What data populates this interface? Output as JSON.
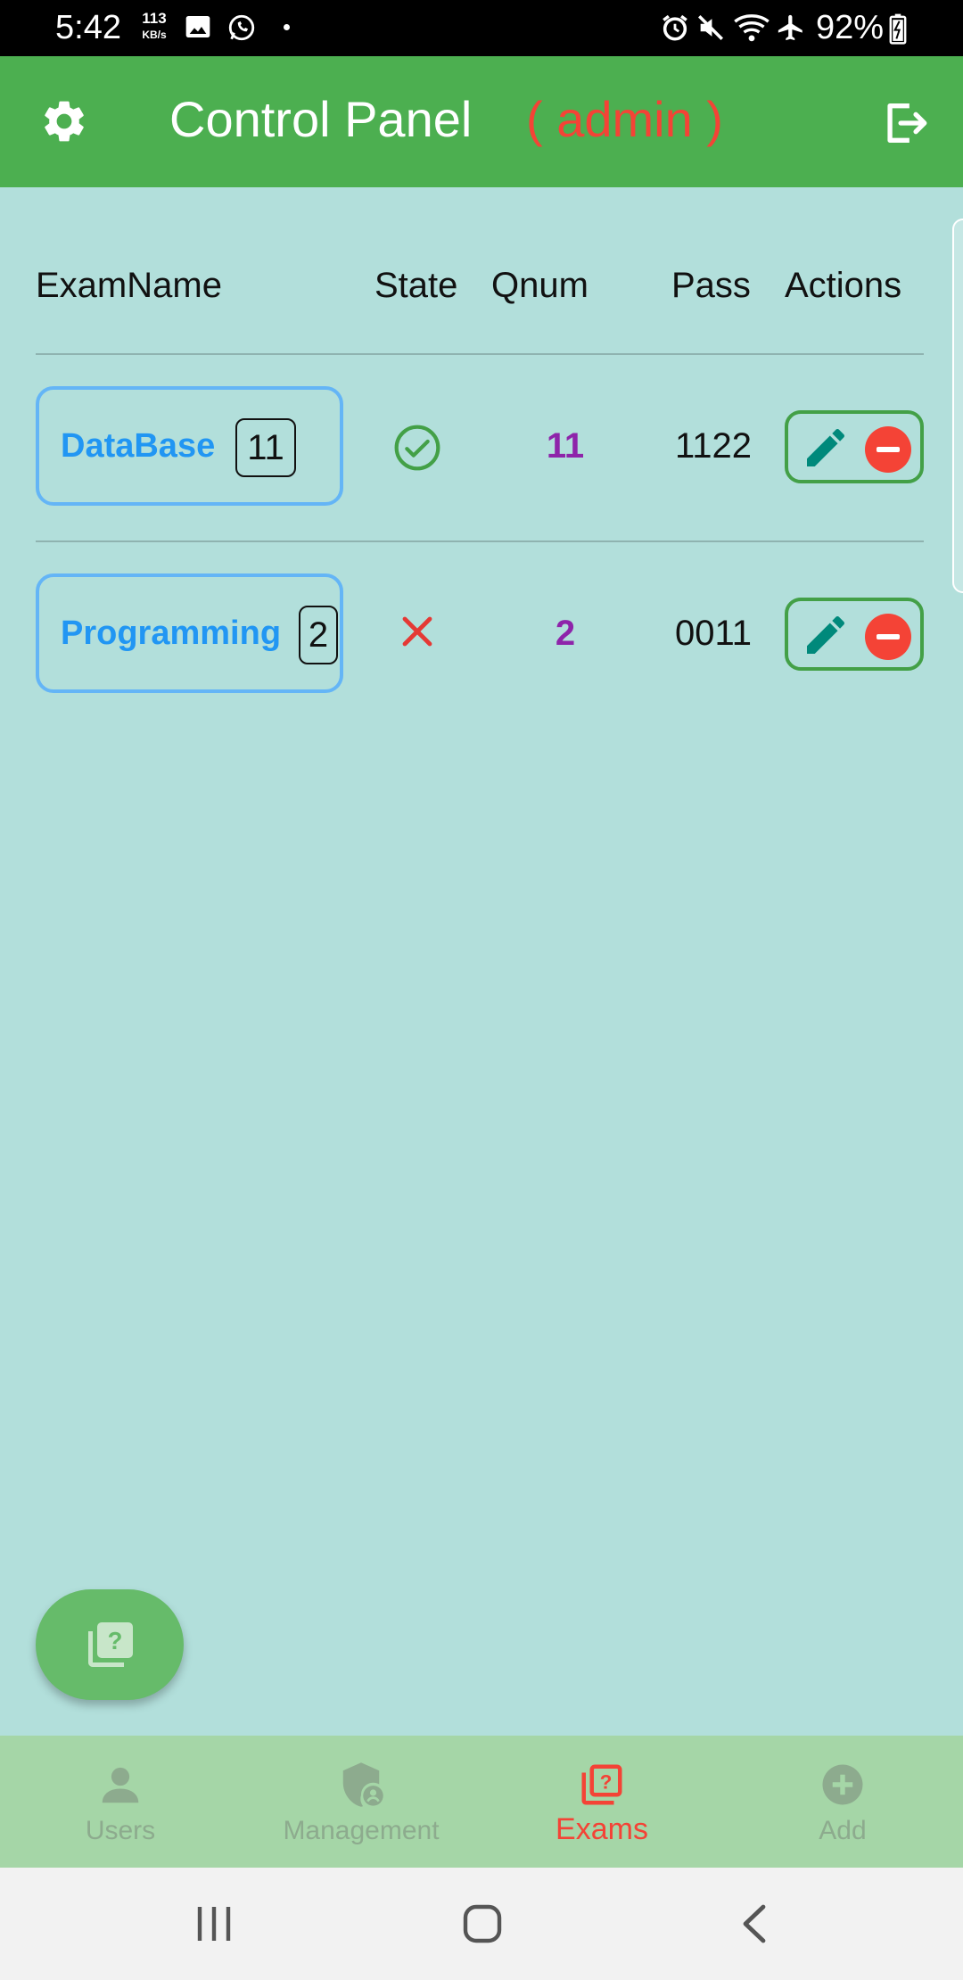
{
  "status_bar": {
    "time": "5:42",
    "net_speed_value": "113",
    "net_speed_unit": "KB/s",
    "battery": "92%",
    "icons": [
      "gallery-icon",
      "whatsapp-icon",
      "alarm-icon",
      "mute-icon",
      "wifi-icon",
      "airplane-icon",
      "battery-icon"
    ]
  },
  "app_bar": {
    "title": "Control Panel",
    "role": "( admin )",
    "settings_icon": "gear-icon",
    "logout_icon": "logout-icon"
  },
  "table": {
    "headers": {
      "exam_name": "ExamName",
      "state": "State",
      "qnum": "Qnum",
      "pass": "Pass",
      "actions": "Actions"
    },
    "rows": [
      {
        "name": "DataBase",
        "count": "11",
        "state": "active",
        "state_icon": "check-circle-icon",
        "qnum": "11",
        "pass": "1122"
      },
      {
        "name": "Programming",
        "count": "2",
        "state": "inactive",
        "state_icon": "close-icon",
        "qnum": "2",
        "pass": "0011"
      }
    ]
  },
  "fab": {
    "icon": "quiz-icon"
  },
  "bottom_nav": {
    "active": "Exams",
    "items": [
      {
        "label": "Users",
        "icon": "person-icon"
      },
      {
        "label": "Management",
        "icon": "admin-shield-icon"
      },
      {
        "label": "Exams",
        "icon": "quiz-icon"
      },
      {
        "label": "Add",
        "icon": "add-circle-icon"
      }
    ]
  },
  "colors": {
    "app_bar": "#4caf50",
    "background": "#b2dfdb",
    "role": "#f44336",
    "exam_name": "#2196f3",
    "qnum": "#8e24aa",
    "bottom_nav": "#a5d6a7",
    "active_nav": "#f44336"
  }
}
